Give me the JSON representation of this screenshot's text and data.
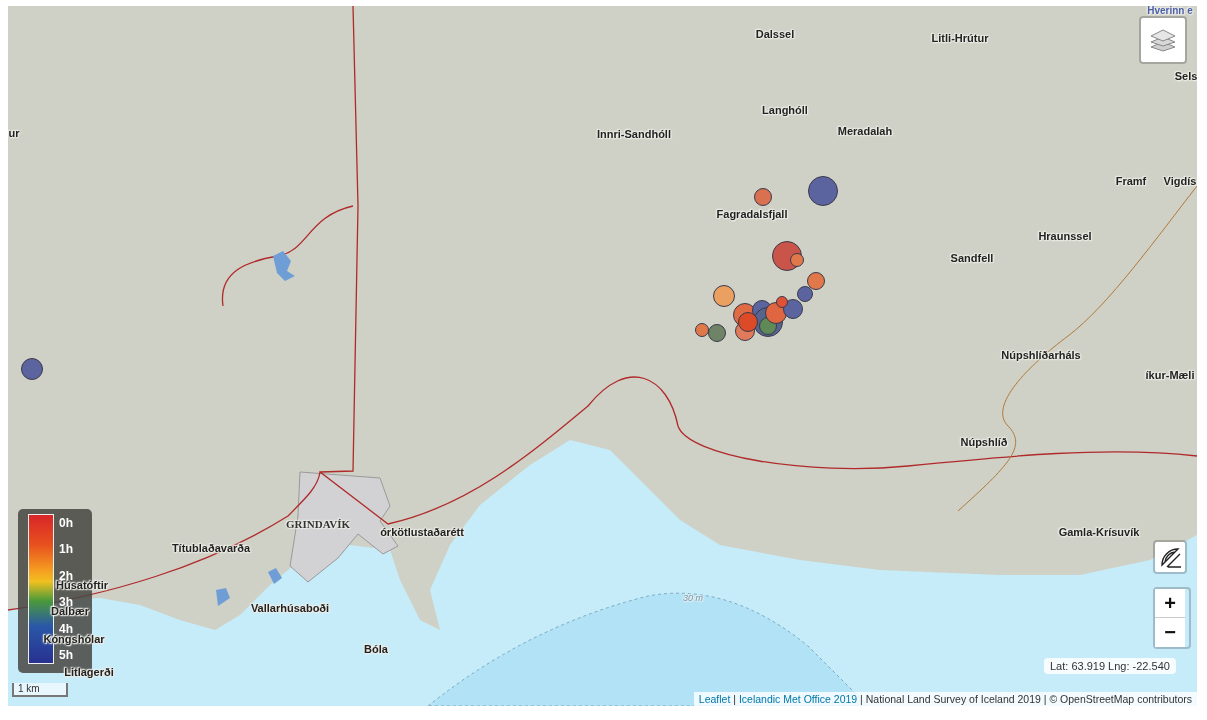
{
  "map": {
    "place_labels": [
      {
        "text": "Hverinn e",
        "kind": "feature"
      },
      {
        "text": "Dalssel",
        "kind": "place"
      },
      {
        "text": "Litli-Hrútur",
        "kind": "place"
      },
      {
        "text": "Sels",
        "kind": "place"
      },
      {
        "text": "ur",
        "kind": "place"
      },
      {
        "text": "Innri-Sandhóll",
        "kind": "place"
      },
      {
        "text": "Langhóll",
        "kind": "place"
      },
      {
        "text": "Meradalah",
        "kind": "place"
      },
      {
        "text": "Framf",
        "kind": "place"
      },
      {
        "text": "Vigdís",
        "kind": "place"
      },
      {
        "text": "Fagradalsfjall",
        "kind": "place"
      },
      {
        "text": "Hraunssel",
        "kind": "place"
      },
      {
        "text": "Sandfell",
        "kind": "place"
      },
      {
        "text": "Núpshlíðarháls",
        "kind": "place"
      },
      {
        "text": "íkur-Mæli",
        "kind": "place"
      },
      {
        "text": "Núpshlíð",
        "kind": "place"
      },
      {
        "text": "GRINDAVÍK",
        "kind": "town"
      },
      {
        "text": "órkötlustaðarétt",
        "kind": "place"
      },
      {
        "text": "Títublaðavarða",
        "kind": "place"
      },
      {
        "text": "Húsatóftir",
        "kind": "place"
      },
      {
        "text": "Dalbær",
        "kind": "place"
      },
      {
        "text": "Vallarhúsaboði",
        "kind": "place"
      },
      {
        "text": "Kóngshólar",
        "kind": "place"
      },
      {
        "text": "Bóla",
        "kind": "place"
      },
      {
        "text": "Litlagerði",
        "kind": "place"
      },
      {
        "text": "Gamla-Krísuvík",
        "kind": "place"
      },
      {
        "text": "30 m",
        "kind": "depth"
      }
    ],
    "earthquakes": [
      {
        "color": "#5c64a0"
      },
      {
        "color": "#d9704f"
      },
      {
        "color": "#5c64a0"
      },
      {
        "color": "#c9544a"
      },
      {
        "color": "#e0784a"
      },
      {
        "color": "#e0784a"
      },
      {
        "color": "#5c64a0"
      },
      {
        "color": "#eaa060"
      },
      {
        "color": "#e0784a"
      },
      {
        "color": "#6f8466"
      },
      {
        "color": "#e06a44"
      },
      {
        "color": "#5c64a0"
      },
      {
        "color": "#56658f"
      },
      {
        "color": "#5f8a58"
      },
      {
        "color": "#df6640"
      },
      {
        "color": "#5c64a0"
      },
      {
        "color": "#e07a5a"
      },
      {
        "color": "#dd4a28"
      },
      {
        "color": "#e05236"
      }
    ],
    "legend": {
      "labels": [
        "0h",
        "1h",
        "2h",
        "3h",
        "4h",
        "5h"
      ]
    },
    "scale": "1 km",
    "coordinates": "Lat: 63.919 Lng: -22.540",
    "controls": {
      "zoom_in": "+",
      "zoom_out": "−"
    },
    "attribution": [
      {
        "text": "Leaflet",
        "kind": "link"
      },
      {
        "text": " | ",
        "kind": "text"
      },
      {
        "text": "Icelandic Met Office 2019",
        "kind": "link"
      },
      {
        "text": " | National Land Survey of Iceland 2019 | © OpenStreetMap contributors",
        "kind": "text"
      }
    ]
  }
}
